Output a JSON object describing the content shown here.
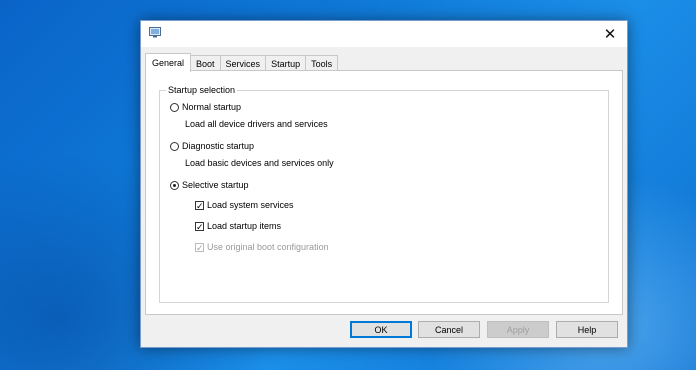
{
  "titlebar": {
    "title": "",
    "close_glyph": "✕",
    "app_icon": "msconfig-icon"
  },
  "tabs": [
    {
      "label": "General",
      "active": true
    },
    {
      "label": "Boot",
      "active": false
    },
    {
      "label": "Services",
      "active": false
    },
    {
      "label": "Startup",
      "active": false
    },
    {
      "label": "Tools",
      "active": false
    }
  ],
  "startup_selection": {
    "group_label": "Startup selection",
    "normal": {
      "label": "Normal startup",
      "description": "Load all device drivers and services",
      "selected": false
    },
    "diagnostic": {
      "label": "Diagnostic startup",
      "description": "Load basic devices and services only",
      "selected": false
    },
    "selective": {
      "label": "Selective startup",
      "selected": true,
      "options": {
        "load_system_services": {
          "label": "Load system services",
          "checked": true,
          "enabled": true
        },
        "load_startup_items": {
          "label": "Load startup items",
          "checked": true,
          "enabled": true
        },
        "use_original_boot": {
          "label": "Use original boot configuration",
          "checked": true,
          "enabled": false
        }
      }
    }
  },
  "buttons": {
    "ok": "OK",
    "cancel": "Cancel",
    "apply": "Apply",
    "help": "Help"
  },
  "colors": {
    "desktop": "#0f7ad8",
    "dialog_bg": "#f0f0f0",
    "default_button_border": "#0078d7"
  }
}
